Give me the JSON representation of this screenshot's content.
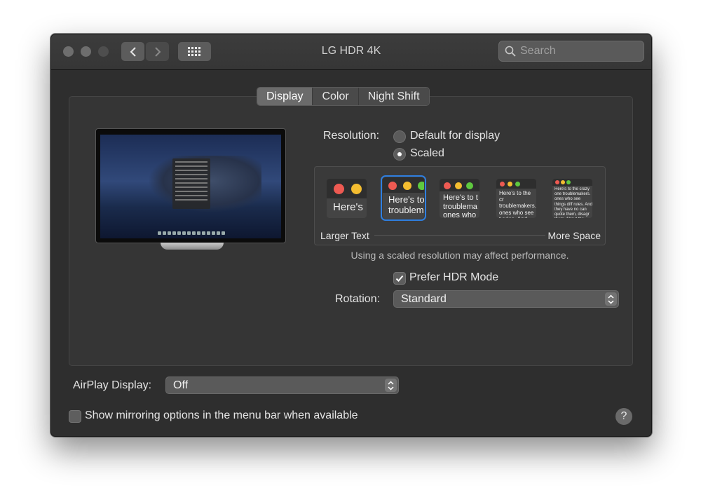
{
  "window": {
    "title": "LG HDR 4K",
    "search_placeholder": "Search"
  },
  "tabs": [
    {
      "label": "Display",
      "active": true
    },
    {
      "label": "Color",
      "active": false
    },
    {
      "label": "Night Shift",
      "active": false
    }
  ],
  "resolution": {
    "label": "Resolution:",
    "options": [
      {
        "label": "Default for display",
        "selected": false
      },
      {
        "label": "Scaled",
        "selected": true
      }
    ],
    "scale_options": [
      {
        "preview_text": "Here's",
        "selected": false
      },
      {
        "preview_text": "Here's to troublem",
        "selected": true
      },
      {
        "preview_text": "Here's to t troublema ones who",
        "selected": false
      },
      {
        "preview_text": "Here's to the cr troublemakers. ones who see t rules. And they",
        "selected": false
      },
      {
        "preview_text": "Here's to the crazy one troublemakers. ones who see things diff rules. And they have no can quote them, disagr them. About the only th Because they change th",
        "selected": false
      }
    ],
    "larger_text_label": "Larger Text",
    "more_space_label": "More Space",
    "performance_note": "Using a scaled resolution may affect performance."
  },
  "hdr": {
    "label": "Prefer HDR Mode",
    "checked": true
  },
  "rotation": {
    "label": "Rotation:",
    "value": "Standard"
  },
  "airplay": {
    "label": "AirPlay Display:",
    "value": "Off"
  },
  "mirroring": {
    "label": "Show mirroring options in the menu bar when available",
    "checked": false
  },
  "help": {
    "label": "?"
  },
  "colors": {
    "accent": "#2f7fe0",
    "close": "#ee5a52",
    "minimize": "#f4bd30",
    "zoom": "#5fc93f"
  }
}
